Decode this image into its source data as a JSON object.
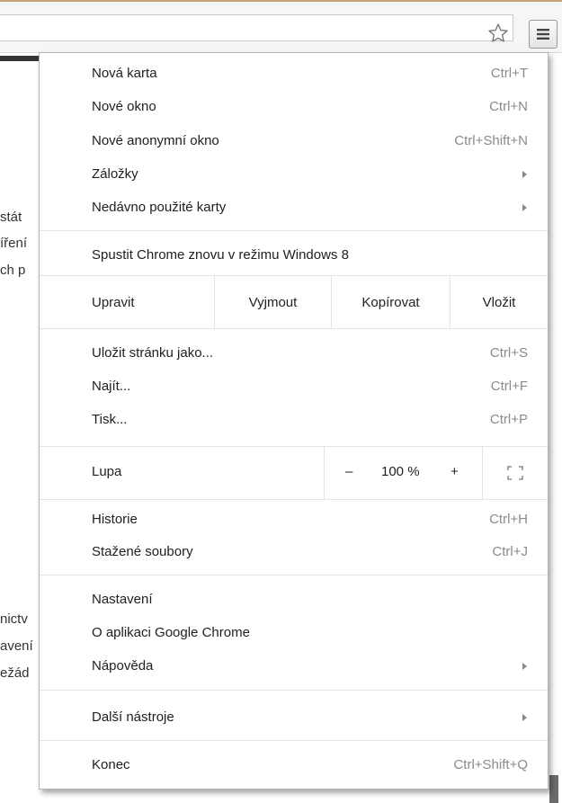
{
  "toolbar": {
    "bookmark_icon": "star-outline-icon",
    "menu_icon": "hamburger-menu-icon"
  },
  "background_fragments": [
    "stát",
    "íření",
    "ch p",
    "nictv",
    "avení",
    "ežád"
  ],
  "menu": {
    "new_tab": {
      "label": "Nová karta",
      "shortcut": "Ctrl+T"
    },
    "new_window": {
      "label": "Nové okno",
      "shortcut": "Ctrl+N"
    },
    "new_incognito": {
      "label": "Nové anonymní okno",
      "shortcut": "Ctrl+Shift+N"
    },
    "bookmarks": {
      "label": "Záložky"
    },
    "recent_tabs": {
      "label": "Nedávno použité karty"
    },
    "relaunch": {
      "label": "Spustit Chrome znovu v režimu Windows 8"
    },
    "edit": {
      "label": "Upravit",
      "cut": "Vyjmout",
      "copy": "Kopírovat",
      "paste": "Vložit"
    },
    "save_page": {
      "label": "Uložit stránku jako...",
      "shortcut": "Ctrl+S"
    },
    "find": {
      "label": "Najít...",
      "shortcut": "Ctrl+F"
    },
    "print": {
      "label": "Tisk...",
      "shortcut": "Ctrl+P"
    },
    "zoom": {
      "label": "Lupa",
      "minus": "–",
      "value": "100 %",
      "plus": "+",
      "fullscreen_icon": "fullscreen-icon"
    },
    "history": {
      "label": "Historie",
      "shortcut": "Ctrl+H"
    },
    "downloads": {
      "label": "Stažené soubory",
      "shortcut": "Ctrl+J"
    },
    "settings": {
      "label": "Nastavení"
    },
    "about": {
      "label": "O aplikaci Google Chrome"
    },
    "help": {
      "label": "Nápověda"
    },
    "more_tools": {
      "label": "Další nástroje"
    },
    "exit": {
      "label": "Konec",
      "shortcut": "Ctrl+Shift+Q"
    }
  }
}
